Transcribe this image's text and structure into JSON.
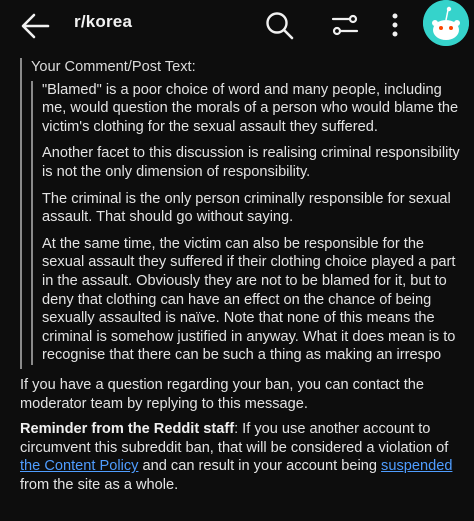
{
  "header": {
    "subreddit": "r/korea",
    "icons": [
      "back-arrow-icon",
      "search-icon",
      "filter-icon",
      "more-vertical-icon",
      "snoo-avatar-icon"
    ],
    "avatar_bg": "#35d3cb"
  },
  "message": {
    "quote_heading": "Your Comment/Post Text:",
    "quoted_paragraphs": [
      "\"Blamed\" is a poor choice of word and many people, including me, would question the morals of a person who would blame the victim's clothing for the sexual assault they suffered.",
      "Another facet to this discussion is realising criminal responsibility is not the only dimension of responsibility.",
      "The criminal is the only person criminally responsible for sexual assault. That should go without saying.",
      "At the same time, the victim can also be responsible for the sexual assault they suffered if their clothing choice played a part in the assault. Obviously they are not to be blamed for it, but to deny that clothing can have an effect on the chance of being sexually assaulted is naïve. Note that none of this means the criminal is somehow justified in anyway. What it does mean is to recognise that there can be such a thing as making an irrespo"
    ],
    "contact_text": "If you have a question regarding your ban, you can contact the moderator team by replying to this message.",
    "reminder": {
      "label": "Reminder from the Reddit staff",
      "text_1": ": If you use another account to circumvent this subreddit ban, that will be considered a violation of ",
      "link_1": "the Content Policy",
      "text_2": " and can result in your account being ",
      "link_2": "suspended",
      "text_3": " from the site as a whole."
    }
  }
}
